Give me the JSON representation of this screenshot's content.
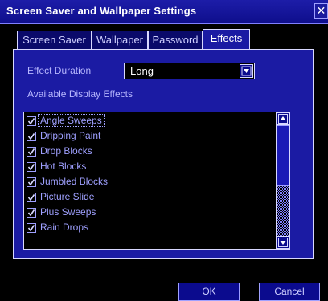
{
  "window": {
    "title": "Screen Saver and Wallpaper Settings",
    "close_glyph": "✕"
  },
  "tabs": [
    {
      "label": "Screen Saver",
      "active": false
    },
    {
      "label": "Wallpaper",
      "active": false
    },
    {
      "label": "Password",
      "active": false
    },
    {
      "label": "Effects",
      "active": true
    }
  ],
  "effects": {
    "duration_label": "Effect Duration",
    "duration_value": "Long",
    "list_label": "Available Display Effects",
    "items": [
      {
        "label": "Angle Sweeps",
        "checked": true,
        "selected": true
      },
      {
        "label": "Dripping Paint",
        "checked": true
      },
      {
        "label": "Drop Blocks",
        "checked": true
      },
      {
        "label": "Hot Blocks",
        "checked": true
      },
      {
        "label": "Jumbled Blocks",
        "checked": true
      },
      {
        "label": "Picture Slide",
        "checked": true
      },
      {
        "label": "Plus Sweeps",
        "checked": true
      },
      {
        "label": "Rain Drops",
        "checked": true
      }
    ]
  },
  "buttons": {
    "ok": "OK",
    "cancel": "Cancel"
  },
  "colors": {
    "title_bg": "#1d1da8",
    "panel_bg": "#1b1ba3",
    "text": "#9fa0ff",
    "border": "#d8d8ff"
  }
}
